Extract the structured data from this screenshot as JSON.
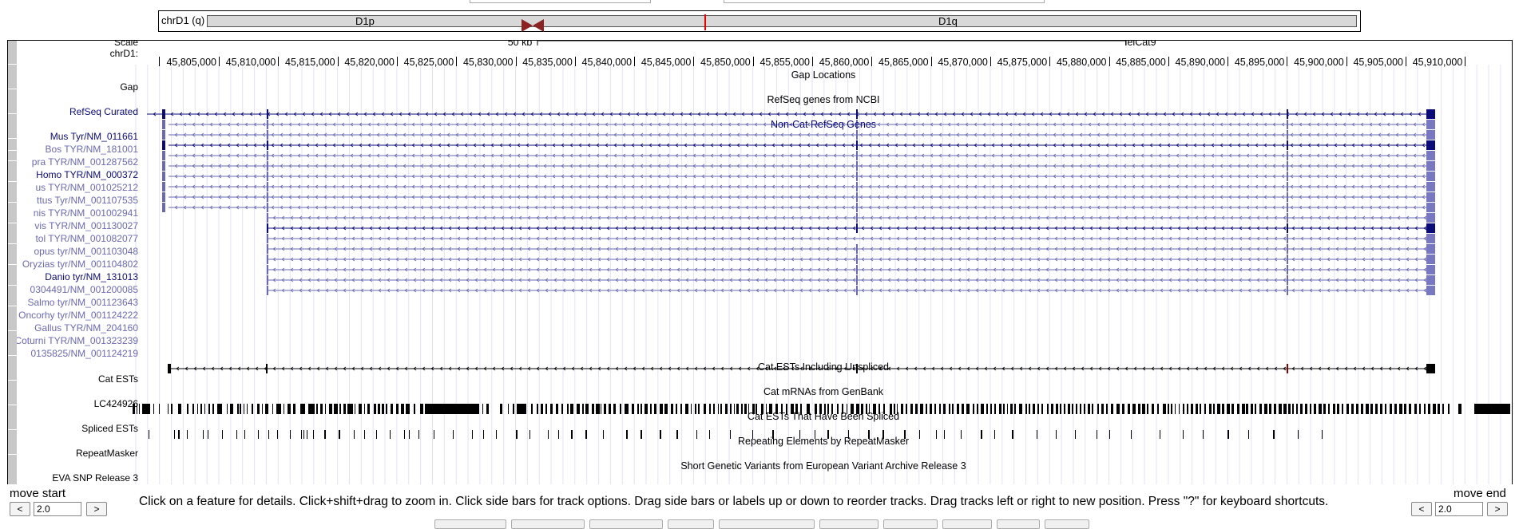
{
  "ideogram": {
    "chrom_label": "chrD1 (q)",
    "band_p": "D1p",
    "band_q": "D1q"
  },
  "ruler": {
    "scale_label": "Scale",
    "chrom_label": "chrD1:",
    "scale_bar_label": "50 kb",
    "assembly": "felCat9",
    "ticks": [
      "45,805,000",
      "45,810,000",
      "45,815,000",
      "45,820,000",
      "45,825,000",
      "45,830,000",
      "45,835,000",
      "45,840,000",
      "45,845,000",
      "45,850,000",
      "45,855,000",
      "45,860,000",
      "45,865,000",
      "45,870,000",
      "45,875,000",
      "45,880,000",
      "45,885,000",
      "45,890,000",
      "45,895,000",
      "45,900,000",
      "45,905,000",
      "45,910,000"
    ]
  },
  "tracks": {
    "gap": {
      "label": "Gap",
      "title": "Gap Locations"
    },
    "refseq": {
      "label": "RefSeq Curated",
      "title": "RefSeq genes from NCBI"
    },
    "noncat": {
      "title": "Non-Cat RefSeq Genes"
    },
    "cat_ests": {
      "label": "Cat ESTs",
      "title": "Cat ESTs Including Unspliced"
    },
    "cat_mrnas": {
      "title": "Cat mRNAs from GenBank",
      "item": "LC424926"
    },
    "spliced": {
      "label": "Spliced ESTs",
      "title": "Cat ESTs That Have Been Spliced"
    },
    "repeat": {
      "label": "RepeatMasker",
      "title": "Repeating Elements by RepeatMasker"
    },
    "eva": {
      "label": "EVA SNP Release 3",
      "title": "Short Genetic Variants from European Variant Archive Release 3"
    }
  },
  "genes": [
    {
      "label": "Mus Tyr/NM_011661",
      "style": "navy"
    },
    {
      "label": "Bos TYR/NM_181001",
      "style": "faded"
    },
    {
      "label": "pra TYR/NM_001287562",
      "style": "faded"
    },
    {
      "label": "Homo TYR/NM_000372",
      "style": "navy"
    },
    {
      "label": "us TYR/NM_001025212",
      "style": "faded"
    },
    {
      "label": "ttus Tyr/NM_001107535",
      "style": "faded"
    },
    {
      "label": "nis TYR/NM_001002941",
      "style": "faded"
    },
    {
      "label": "vis TYR/NM_001130027",
      "style": "faded"
    },
    {
      "label": "tol TYR/NM_001082077",
      "style": "faded"
    },
    {
      "label": "opus tyr/NM_001103048",
      "style": "faded"
    },
    {
      "label": "Oryzias tyr/NM_001104802",
      "style": "faded"
    },
    {
      "label": "Danio tyr/NM_131013",
      "style": "navy"
    },
    {
      "label": "0304491/NM_001200085",
      "style": "faded"
    },
    {
      "label": "Salmo tyr/NM_001123643",
      "style": "faded"
    },
    {
      "label": "Oncorhy tyr/NM_001124222",
      "style": "faded"
    },
    {
      "label": "Gallus TYR/NM_204160",
      "style": "faded"
    },
    {
      "label": "Coturni TYR/NM_001323239",
      "style": "faded"
    },
    {
      "label": "0135825/NM_001124219",
      "style": "faded"
    }
  ],
  "controls": {
    "move_start": "move start",
    "move_end": "move end",
    "left_value": "2.0",
    "right_value": "2.0",
    "left_arrow": "<",
    "right_arrow": ">",
    "help_text": "Click on a feature for details. Click+shift+drag to zoom in. Click side bars for track options. Drag side bars or labels up or down to reorder tracks. Drag tracks left or right to new position. Press \"?\" for keyboard shortcuts."
  }
}
